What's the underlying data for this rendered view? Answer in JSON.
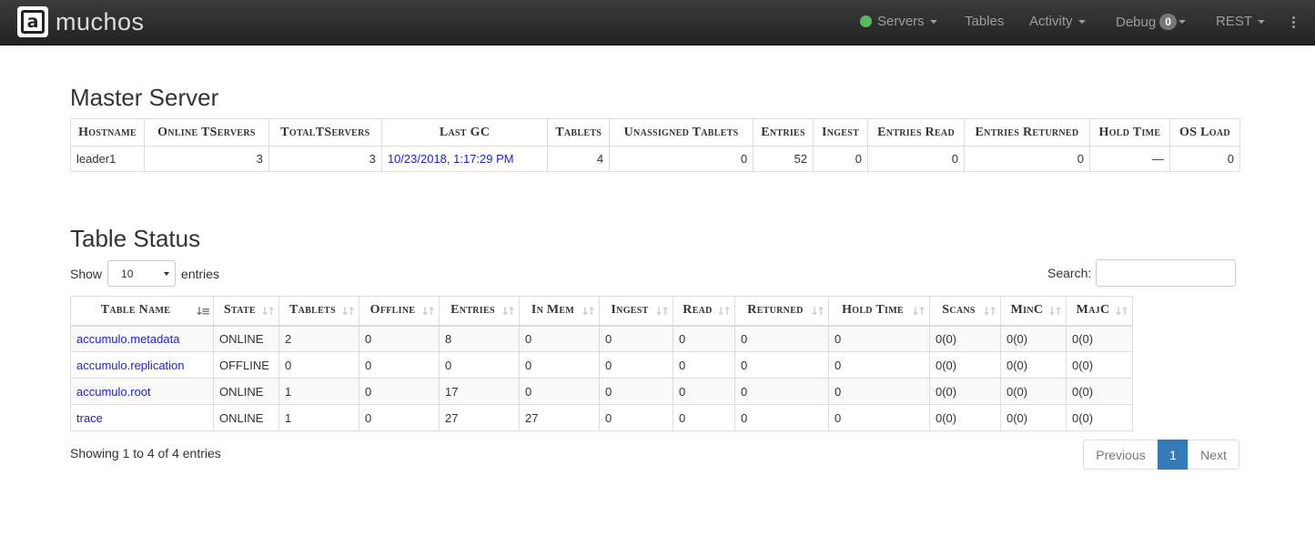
{
  "navbar": {
    "brand_letter": "a",
    "brand_name": "muchos",
    "items": {
      "servers": "Servers",
      "tables": "Tables",
      "activity": "Activity",
      "debug": "Debug",
      "debug_count": "0",
      "rest": "REST"
    },
    "status_color": "#5cb85c"
  },
  "master": {
    "title": "Master Server",
    "headers": [
      "Hostname",
      "Online TServers",
      "TotalTServers",
      "Last GC",
      "Tablets",
      "Unassigned Tablets",
      "Entries",
      "Ingest",
      "Entries Read",
      "Entries Returned",
      "Hold Time",
      "OS Load"
    ],
    "row": [
      "leader1",
      "3",
      "3",
      "10/23/2018, 1:17:29 PM",
      "4",
      "0",
      "52",
      "0",
      "0",
      "0",
      "—",
      "0"
    ]
  },
  "table_status": {
    "title": "Table Status",
    "show_label": "Show",
    "entries_label": "entries",
    "page_size": "10",
    "search_label": "Search:",
    "search_value": "",
    "headers": [
      "Table Name",
      "State",
      "Tablets",
      "Offline",
      "Entries",
      "In Mem",
      "Ingest",
      "Read",
      "Returned",
      "Hold Time",
      "Scans",
      "MinC",
      "MajC"
    ],
    "rows": [
      [
        "accumulo.metadata",
        "ONLINE",
        "2",
        "0",
        "8",
        "0",
        "0",
        "0",
        "0",
        "0",
        "0(0)",
        "0(0)",
        "0(0)"
      ],
      [
        "accumulo.replication",
        "OFFLINE",
        "0",
        "0",
        "0",
        "0",
        "0",
        "0",
        "0",
        "0",
        "0(0)",
        "0(0)",
        "0(0)"
      ],
      [
        "accumulo.root",
        "ONLINE",
        "1",
        "0",
        "17",
        "0",
        "0",
        "0",
        "0",
        "0",
        "0(0)",
        "0(0)",
        "0(0)"
      ],
      [
        "trace",
        "ONLINE",
        "1",
        "0",
        "27",
        "27",
        "0",
        "0",
        "0",
        "0",
        "0(0)",
        "0(0)",
        "0(0)"
      ]
    ],
    "info": "Showing 1 to 4 of 4 entries",
    "pager": {
      "previous": "Previous",
      "current": "1",
      "next": "Next"
    }
  }
}
